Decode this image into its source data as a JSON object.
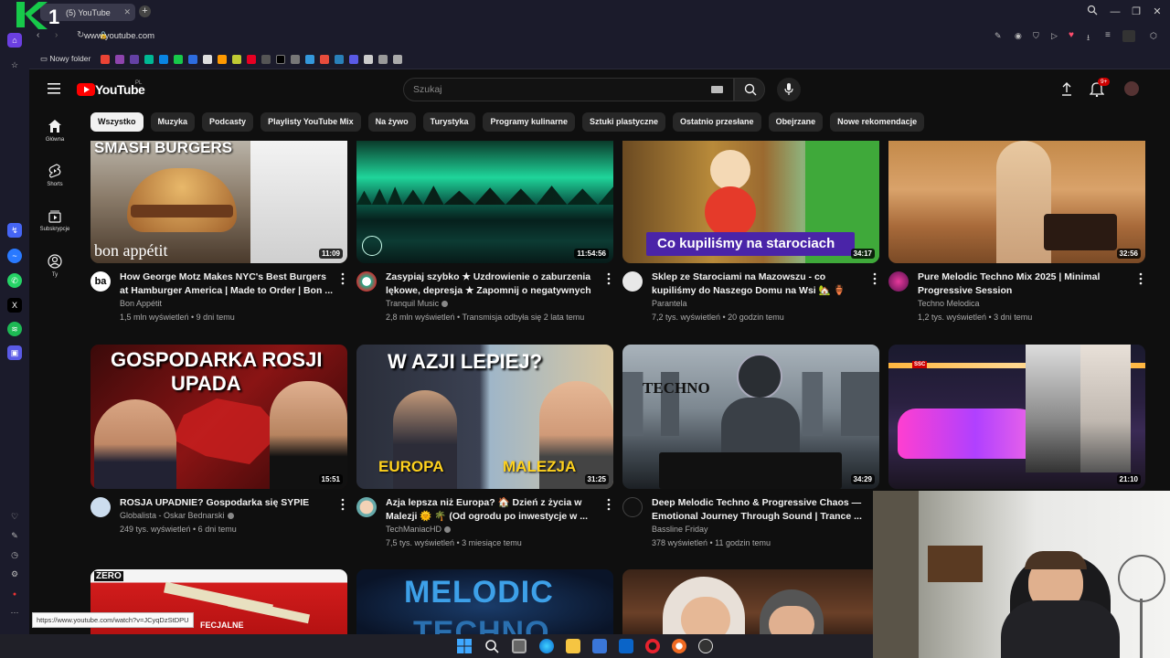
{
  "browser": {
    "logo_letters": "K1",
    "tab_title": "(5) YouTube",
    "url": "www.youtube.com",
    "bookmark_folder": "Nowy folder",
    "status_url": "https://www.youtube.com/watch?v=JCyqDzStDPU"
  },
  "youtube": {
    "logo_text": "YouTube",
    "region": "PL",
    "search_placeholder": "Szukaj",
    "notification_badge": "9+",
    "nav": [
      {
        "label": "Główna",
        "icon": "home-icon"
      },
      {
        "label": "Shorts",
        "icon": "shorts-icon"
      },
      {
        "label": "Subskrypcje",
        "icon": "subscriptions-icon"
      },
      {
        "label": "Ty",
        "icon": "you-icon"
      }
    ],
    "chips": [
      "Wszystko",
      "Muzyka",
      "Podcasty",
      "Playlisty YouTube Mix",
      "Na żywo",
      "Turystyka",
      "Programy kulinarne",
      "Sztuki plastyczne",
      "Ostatnio przesłane",
      "Obejrzane",
      "Nowe rekomendacje"
    ],
    "videos": [
      {
        "title": "How George Motz Makes NYC's Best Burgers at Hamburger America | Made to Order | Bon ...",
        "channel": "Bon Appétit",
        "verified": false,
        "meta": "1,5 mln wyświetleń • 9 dni temu",
        "duration": "11:09",
        "thumb_text": "SMASH BURGERS",
        "thumb_text2": "bon appétit",
        "avatar_text": "ba"
      },
      {
        "title": "Zasypiaj szybko ★ Uzdrowienie o zaburzenia lękowe, depresja ★ Zapomnij o negatywnych ...",
        "channel": "Tranquil Music",
        "verified": true,
        "meta": "2,8 mln wyświetleń • Transmisja odbyła się 2 lata temu",
        "duration": "11:54:56"
      },
      {
        "title": "Sklep ze Starociami na Mazowszu - co kupiliśmy do Naszego Domu na Wsi 🏡 🏺",
        "channel": "Parantela",
        "verified": false,
        "meta": "7,2 tys. wyświetleń • 20 godzin temu",
        "duration": "34:17",
        "thumb_text": "Co kupiliśmy na starociach"
      },
      {
        "title": "Pure Melodic Techno Mix 2025 | Minimal Progressive Session",
        "channel": "Techno Melodica",
        "verified": false,
        "meta": "1,2 tys. wyświetleń • 3 dni temu",
        "duration": "32:56"
      },
      {
        "title": "ROSJA UPADNIE? Gospodarka się SYPIE",
        "channel": "Globalista - Oskar Bednarski",
        "verified": true,
        "meta": "249 tys. wyświetleń • 6 dni temu",
        "duration": "15:51",
        "thumb_text": "GOSPODARKA ROSJI",
        "thumb_text2": "UPADA"
      },
      {
        "title": "Azja lepsza niż Europa? 🏠 Dzień z życia w Malezji 🌞 🌴 (Od ogrodu po inwestycje w ...",
        "channel": "TechManiacHD",
        "verified": true,
        "meta": "7,5 tys. wyświetleń • 3 miesiące temu",
        "duration": "31:25",
        "thumb_text": "W AZJI LEPIEJ?",
        "thumb_text2": "EUROPA",
        "thumb_text3": "MALEZJA"
      },
      {
        "title": "Deep Melodic Techno & Progressive Chaos — Emotional Journey Through Sound | Trance ...",
        "channel": "Bassline Friday",
        "verified": false,
        "meta": "378 wyświetleń • 11 godzin temu",
        "duration": "34:29",
        "thumb_text": "TECHNO"
      },
      {
        "title": "",
        "channel": "",
        "verified": false,
        "meta": "",
        "duration": "21:10",
        "thumb_text": "SSC"
      }
    ],
    "row3": [
      {
        "thumb_text": "ZERO",
        "thumb_text2": "FECJALNE"
      },
      {
        "thumb_text": "MELODIC",
        "thumb_text2": "TECHNO"
      },
      {
        "thumb_text": ""
      }
    ]
  },
  "colors": {
    "accent_red": "#ff0000",
    "chip_bg": "#272727",
    "chip_active_bg": "#f1f1f1",
    "page_bg": "#0f0f0f",
    "browser_bg": "#1b1b2b"
  }
}
